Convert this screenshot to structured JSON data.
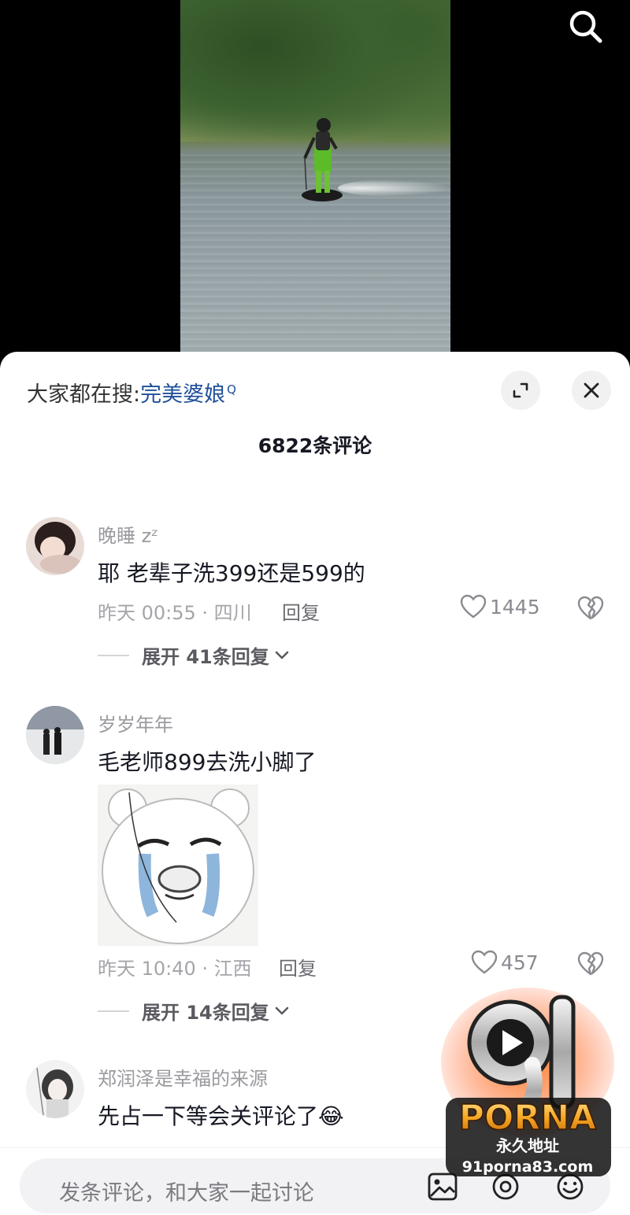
{
  "trend_bar": {
    "prefix": "大家都在搜:",
    "keyword": "完美婆娘"
  },
  "comment_count": "6822条评论",
  "comments": [
    {
      "user": "晚睡 zᶻ",
      "text": "耶 老辈子洗399还是599的",
      "time_loc": "昨天 00:55 · 四川",
      "reply": "回复",
      "likes": "1445",
      "expand": "展开 41条回复"
    },
    {
      "user": "岁岁年年",
      "text": "毛老师899去洗小脚了",
      "time_loc": "昨天 10:40 · 江西",
      "reply": "回复",
      "likes": "457",
      "expand": "展开 14条回复"
    },
    {
      "user": "郑润泽是幸福的来源",
      "text": "先占一下等会关评论了😂"
    }
  ],
  "input": {
    "placeholder": "发条评论，和大家一起讨论"
  },
  "watermark": {
    "logo_number": "91",
    "logo_word": "PORNA",
    "tagline": "永久地址",
    "url": "91porna83.com"
  }
}
